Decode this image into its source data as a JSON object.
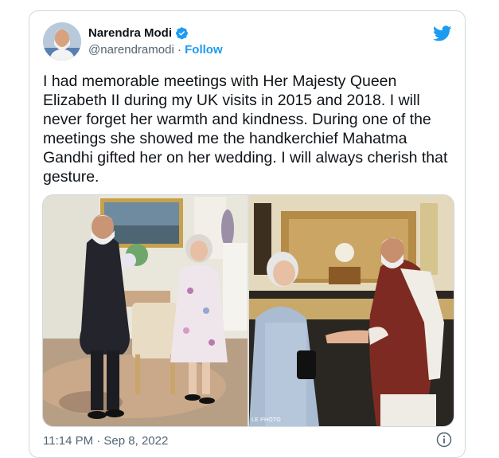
{
  "tweet": {
    "author": {
      "name": "Narendra Modi",
      "handle": "@narendramodi",
      "follow_label": "Follow",
      "separator": " · ",
      "verified": true
    },
    "text": "I had memorable meetings with Her Majesty Queen Elizabeth II during my UK visits in 2015 and 2018. I will never forget her warmth and kindness. During one of the meetings she showed me the handkerchief Mahatma Gandhi gifted her on her wedding. I will always cherish that gesture.",
    "media": {
      "photo_credit": "LE PHOTO"
    },
    "timestamp": "11:14 PM · Sep 8, 2022"
  },
  "icons": {
    "verified": "verified-badge-icon",
    "logo": "twitter-bird-icon",
    "info": "info-icon"
  },
  "colors": {
    "accent": "#1d9bf0",
    "text": "#0f1419",
    "muted": "#536471",
    "border": "#cfd9de"
  }
}
